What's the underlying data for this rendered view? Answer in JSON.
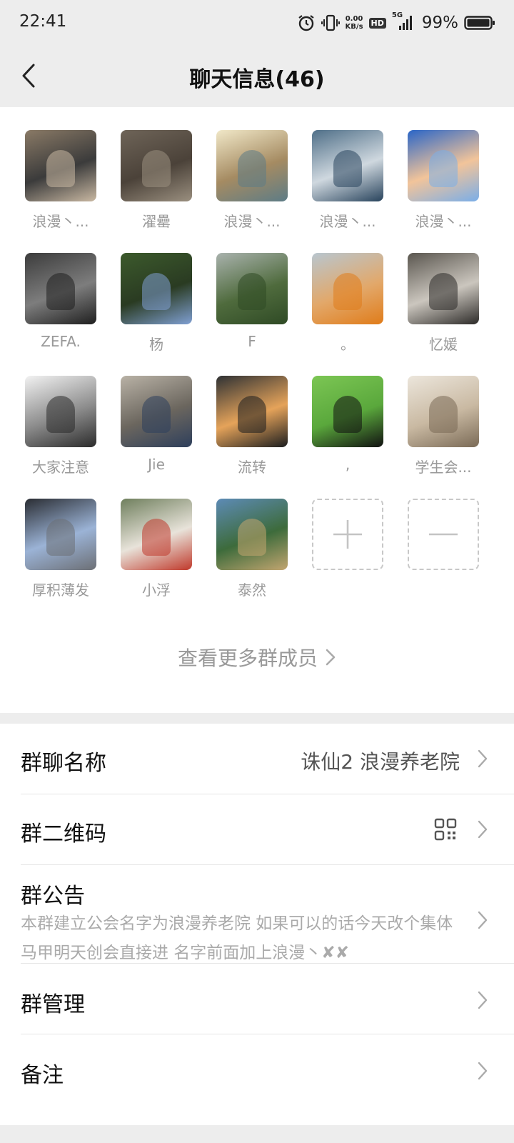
{
  "status_bar": {
    "time": "22:41",
    "net_speed_value": "0.00",
    "net_speed_unit": "KB/s",
    "hd": "HD",
    "network": "5G",
    "battery": "99%",
    "icons": [
      "alarm-icon",
      "vibrate-icon",
      "signal-icon",
      "battery-icon"
    ]
  },
  "header": {
    "title": "聊天信息(46)",
    "back_icon": "chevron-left-icon"
  },
  "members": [
    {
      "name": "浪漫丶...",
      "avatar": "street-couple-photo",
      "colors": [
        "#8a7a66",
        "#3b3b3b",
        "#c9b8a2"
      ]
    },
    {
      "name": "濯罍",
      "avatar": "lizard-on-bamboo-photo",
      "colors": [
        "#6e6458",
        "#4b4239",
        "#9a8f7f"
      ]
    },
    {
      "name": "浪漫丶...",
      "avatar": "cartoon-cat-drawing",
      "colors": [
        "#f1e8c8",
        "#a58b62",
        "#5d7c86"
      ]
    },
    {
      "name": "浪漫丶...",
      "avatar": "fantasy-figure-clouds",
      "colors": [
        "#4f6f88",
        "#cfd8df",
        "#28435c"
      ]
    },
    {
      "name": "浪漫丶...",
      "avatar": "rabbit-with-goggles",
      "colors": [
        "#2a65c7",
        "#f2c49a",
        "#7aaee8"
      ]
    },
    {
      "name": "ZEFA.",
      "avatar": "person-dark-jacket-photo",
      "colors": [
        "#3c3c3c",
        "#7d7d7d",
        "#1f1f1f"
      ]
    },
    {
      "name": "杨",
      "avatar": "miniature-landscape-photo",
      "colors": [
        "#3c5a2c",
        "#2a3b22",
        "#7f9fd2"
      ]
    },
    {
      "name": "F",
      "avatar": "green-mountains-photo",
      "colors": [
        "#a9b2ad",
        "#4f6b3d",
        "#2f4a25"
      ]
    },
    {
      "name": "。",
      "avatar": "child-with-fruit-photo",
      "colors": [
        "#b8c6cf",
        "#e2a86a",
        "#e07c1a"
      ]
    },
    {
      "name": "忆媛",
      "avatar": "young-man-photo",
      "colors": [
        "#5a564f",
        "#cbc6be",
        "#2c2a28"
      ]
    },
    {
      "name": "大家注意",
      "avatar": "manga-soldier-sketch",
      "colors": [
        "#f2f2f2",
        "#8c8c8c",
        "#2b2b2b"
      ]
    },
    {
      "name": "Jie",
      "avatar": "museum-exhibit-photo",
      "colors": [
        "#b9b2a6",
        "#6b665e",
        "#2e3f5c"
      ]
    },
    {
      "name": "流转",
      "avatar": "stylized-man-portrait",
      "colors": [
        "#2e3134",
        "#e5a35a",
        "#1b1d1f"
      ]
    },
    {
      "name": ",",
      "avatar": "black-cat-on-grass",
      "colors": [
        "#7cc654",
        "#5aa83c",
        "#111111"
      ]
    },
    {
      "name": "学生会...",
      "avatar": "family-photo-card",
      "colors": [
        "#ece6dc",
        "#c9b9a2",
        "#7a6a56"
      ]
    },
    {
      "name": "厚积薄发",
      "avatar": "buildings-looking-up-photo",
      "colors": [
        "#2a2d33",
        "#9bb3d6",
        "#6c6f75"
      ]
    },
    {
      "name": "小浮",
      "avatar": "cute-bunny-red-hat",
      "colors": [
        "#6f7f5d",
        "#e8e3da",
        "#c0392b"
      ]
    },
    {
      "name": "泰然",
      "avatar": "river-village-photo",
      "colors": [
        "#5d8bb6",
        "#3d6b3b",
        "#c2a570"
      ]
    }
  ],
  "add_member_icon": "plus-icon",
  "remove_member_icon": "minus-icon",
  "more_members": {
    "label": "查看更多群成员",
    "icon": "chevron-right-icon"
  },
  "settings": {
    "group_name_label": "群聊名称",
    "group_name_value": "诛仙2  浪漫养老院",
    "qr_label": "群二维码",
    "qr_icon": "qr-code-icon",
    "notice_label": "群公告",
    "notice_text": "本群建立公会名字为浪漫养老院 如果可以的话今天改个集体马甲明天创会直接进 名字前面加上浪漫丶✘✘",
    "manage_label": "群管理",
    "remark_label": "备注",
    "chevron_icon": "chevron-right-icon"
  }
}
